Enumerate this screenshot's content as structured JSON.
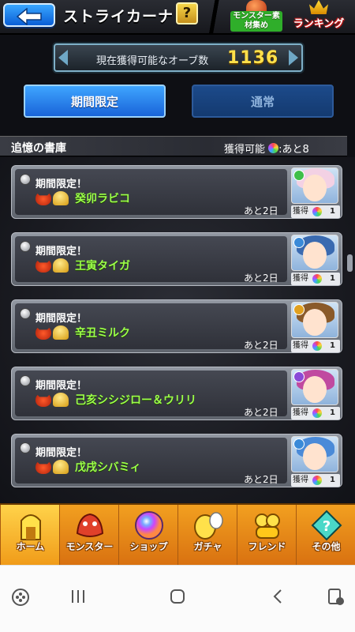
{
  "header": {
    "title": "ストライカーナビ",
    "help_label": "?",
    "materials_label": "モンスター素材集め",
    "ranking_label": "ランキング"
  },
  "orbs": {
    "label": "現在獲得可能なオーブ数",
    "count": "1136"
  },
  "tabs": [
    {
      "label": "期間限定",
      "active": true
    },
    {
      "label": "通常",
      "active": false
    }
  ],
  "section": {
    "title": "追憶の書庫",
    "available_label": "獲得可能",
    "available_remaining": ":あと8"
  },
  "quests": [
    {
      "limited": "期間限定！",
      "name": "癸卯ラビコ",
      "remaining": "あと2日",
      "reward_label": "獲得",
      "reward_count": "1",
      "hair_color": "#f3d1e4",
      "badge_color": "#3fbf4a"
    },
    {
      "limited": "期間限定！",
      "name": "王寅タイガ",
      "remaining": "あと2日",
      "reward_label": "獲得",
      "reward_count": "1",
      "hair_color": "#3a6ab0",
      "badge_color": "#3a8ad8"
    },
    {
      "limited": "期間限定！",
      "name": "辛丑ミルク",
      "remaining": "あと2日",
      "reward_label": "獲得",
      "reward_count": "1",
      "hair_color": "#8a5a2a",
      "badge_color": "#e0a020"
    },
    {
      "limited": "期間限定！",
      "name": "己亥シシジロー＆ウリリ",
      "remaining": "あと2日",
      "reward_label": "獲得",
      "reward_count": "1",
      "hair_color": "#c04aa0",
      "badge_color": "#8a4ad8"
    },
    {
      "limited": "期間限定！",
      "name": "戊戌シバミィ",
      "remaining": "あと2日",
      "reward_label": "獲得",
      "reward_count": "1",
      "hair_color": "#4a8ad8",
      "badge_color": "#3a8ad8"
    }
  ],
  "bottom_nav": [
    {
      "label": "ホーム",
      "icon": "home-icon",
      "active": true
    },
    {
      "label": "モンスター",
      "icon": "monster-icon",
      "active": false
    },
    {
      "label": "ショップ",
      "icon": "shop-orb-icon",
      "active": false
    },
    {
      "label": "ガチャ",
      "icon": "gacha-egg-icon",
      "active": false
    },
    {
      "label": "フレンド",
      "icon": "friend-icon",
      "active": false
    },
    {
      "label": "その他",
      "icon": "other-icon",
      "active": false
    }
  ],
  "colors": {
    "accent_blue": "#1863d8",
    "name_green": "#9cff4a",
    "orb_yellow": "#ffe04a",
    "nav_orange": "#f09a18"
  }
}
